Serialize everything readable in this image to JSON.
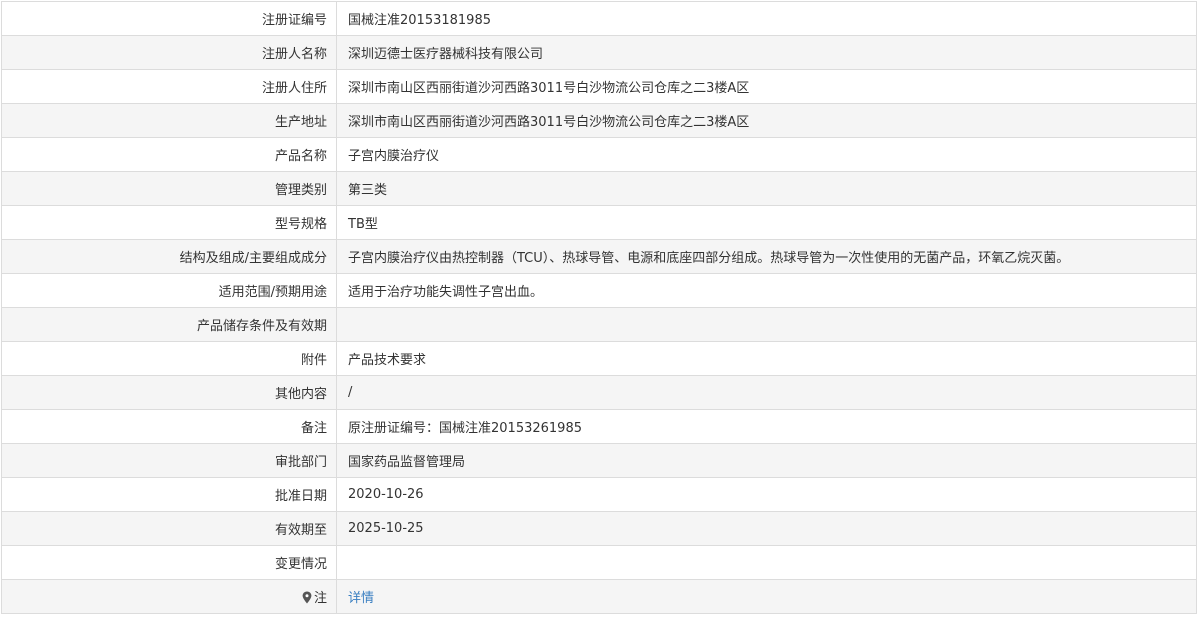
{
  "rows": [
    {
      "label": "注册证编号",
      "value": "国械注准20153181985"
    },
    {
      "label": "注册人名称",
      "value": "深圳迈德士医疗器械科技有限公司"
    },
    {
      "label": "注册人住所",
      "value": "深圳市南山区西丽街道沙河西路3011号白沙物流公司仓库之二3楼A区"
    },
    {
      "label": "生产地址",
      "value": "深圳市南山区西丽街道沙河西路3011号白沙物流公司仓库之二3楼A区"
    },
    {
      "label": "产品名称",
      "value": "子宫内膜治疗仪"
    },
    {
      "label": "管理类别",
      "value": "第三类"
    },
    {
      "label": "型号规格",
      "value": "TB型"
    },
    {
      "label": "结构及组成/主要组成成分",
      "value": "子宫内膜治疗仪由热控制器（TCU）、热球导管、电源和底座四部分组成。热球导管为一次性使用的无菌产品，环氧乙烷灭菌。"
    },
    {
      "label": "适用范围/预期用途",
      "value": "适用于治疗功能失调性子宫出血。"
    },
    {
      "label": "产品储存条件及有效期",
      "value": ""
    },
    {
      "label": "附件",
      "value": "产品技术要求"
    },
    {
      "label": "其他内容",
      "value": "/"
    },
    {
      "label": "备注",
      "value": "原注册证编号：国械注准20153261985"
    },
    {
      "label": "审批部门",
      "value": "国家药品监督管理局"
    },
    {
      "label": "批准日期",
      "value": "2020-10-26"
    },
    {
      "label": "有效期至",
      "value": "2025-10-25"
    },
    {
      "label": "变更情况",
      "value": ""
    }
  ],
  "note_row": {
    "icon": "map-pin-icon",
    "label": "注",
    "link": "详情",
    "link_color": "#3a7fc1"
  }
}
